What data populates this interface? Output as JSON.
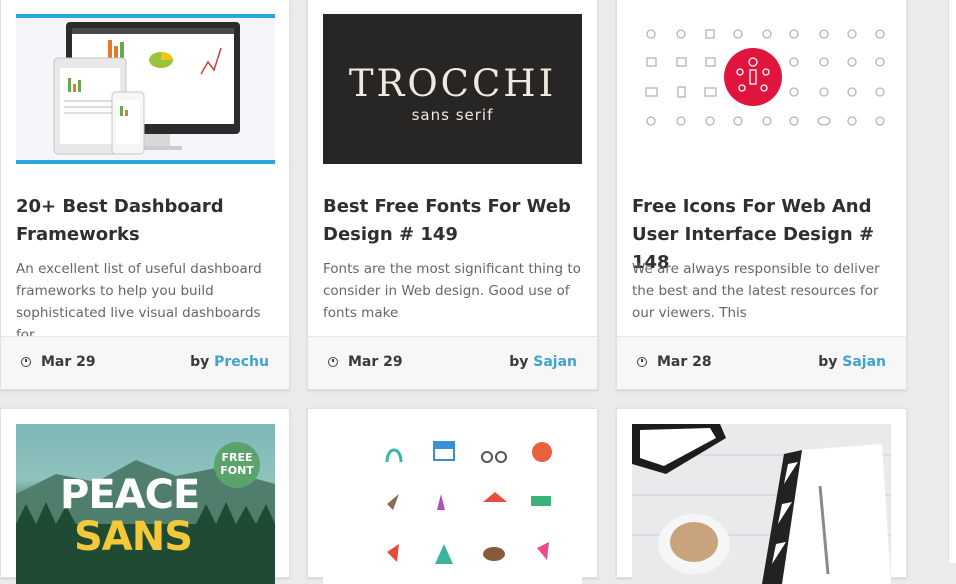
{
  "cards": [
    {
      "title": "20+ Best Dashboard Frameworks",
      "excerpt": "An excellent list of useful dashboard frameworks to help you build sophisticated live visual dashboards for",
      "date": "Mar 29",
      "by": "by",
      "author": "Prechu"
    },
    {
      "title": "Best Free Fonts For Web Design # 149",
      "excerpt": "Fonts are the most significant thing to consider in Web design. Good use of fonts make",
      "date": "Mar 29",
      "by": "by",
      "author": "Sajan",
      "thumb_text": {
        "big": "TROCCHI",
        "small": "sans serif"
      }
    },
    {
      "title": "Free Icons For Web And User Interface Design # 148",
      "excerpt": "We are always responsible to deliver the best and the latest resources for our viewers. This",
      "date": "Mar 28",
      "by": "by",
      "author": "Sajan"
    },
    {
      "thumb_text": {
        "word1": "PEACE",
        "word2": "SANS",
        "badge_line1": "FREE",
        "badge_line2": "FONT"
      }
    },
    {},
    {}
  ],
  "colors": {
    "accent_link": "#3fa3cf",
    "background": "#ebebeb",
    "icon_highlight": "#e0143c"
  }
}
